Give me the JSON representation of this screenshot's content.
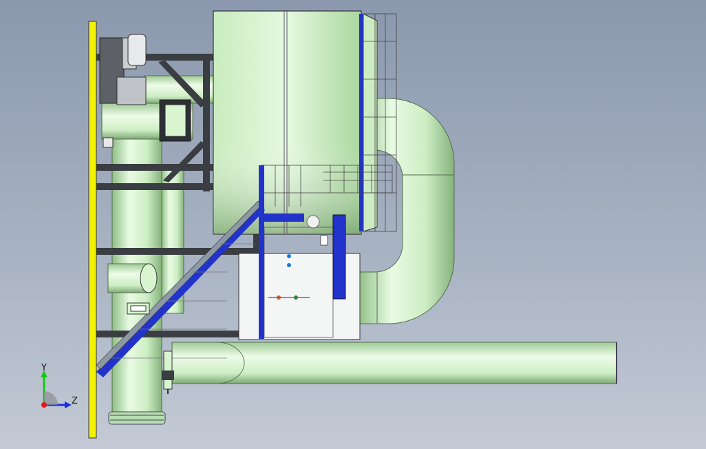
{
  "view": {
    "background_top": "#8b98ad",
    "background_bottom": "#c3cad5",
    "pipe_color": "#d8f5cf",
    "pipe_shadow": "#8fbf86",
    "structure_color": "#3c3f44",
    "accent_blue": "#2233cc",
    "wall_yellow": "#f2f200"
  },
  "triad": {
    "y_label": "Y",
    "z_label": "Z",
    "y_color": "#14c814",
    "z_color": "#1a2ee6",
    "origin_color": "#e01a1a"
  }
}
